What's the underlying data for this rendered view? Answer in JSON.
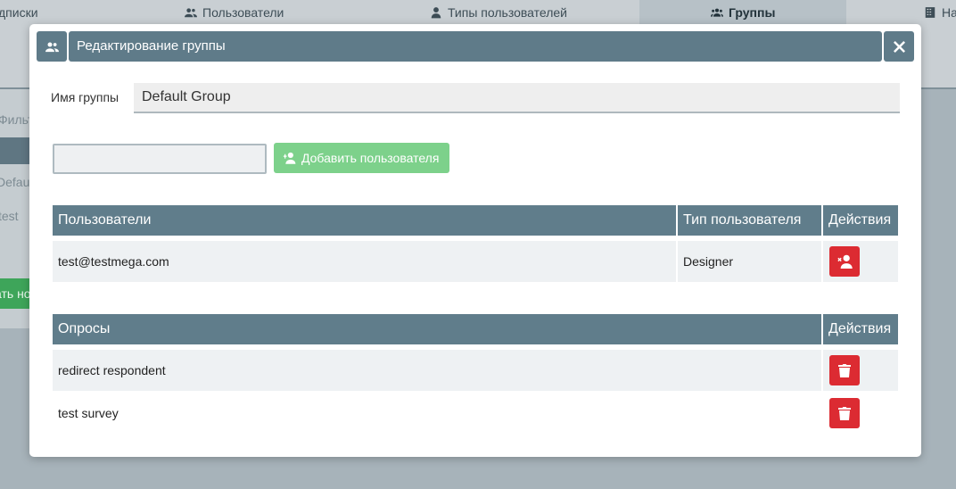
{
  "background": {
    "tabs": [
      {
        "label": "дписки",
        "icon": "none"
      },
      {
        "label": "Пользователи",
        "icon": "users-icon"
      },
      {
        "label": "Типы пользователей",
        "icon": "user-type-icon"
      },
      {
        "label": "Группы",
        "icon": "groups-icon",
        "active": true
      },
      {
        "label": "Нас",
        "icon": "building-icon"
      }
    ],
    "left_texts": [
      "Фильт",
      "Defau",
      "test"
    ],
    "left_button": "ать но"
  },
  "modal": {
    "title": "Редактирование группы",
    "group_name_label": "Имя группы",
    "group_name_value": "Default Group",
    "user_input_value": "",
    "add_user_button": "Добавить пользователя",
    "users_table": {
      "headers": [
        "Пользователи",
        "Тип пользователя",
        "Действия"
      ],
      "rows": [
        {
          "email": "test@testmega.com",
          "type": "Designer"
        }
      ]
    },
    "surveys_table": {
      "headers": [
        "Опросы",
        "Действия"
      ],
      "rows": [
        {
          "name": "redirect respondent"
        },
        {
          "name": "test survey"
        }
      ]
    }
  },
  "colors": {
    "header": "#607d8b",
    "danger": "#dc2b32",
    "success": "#7dd18b"
  }
}
